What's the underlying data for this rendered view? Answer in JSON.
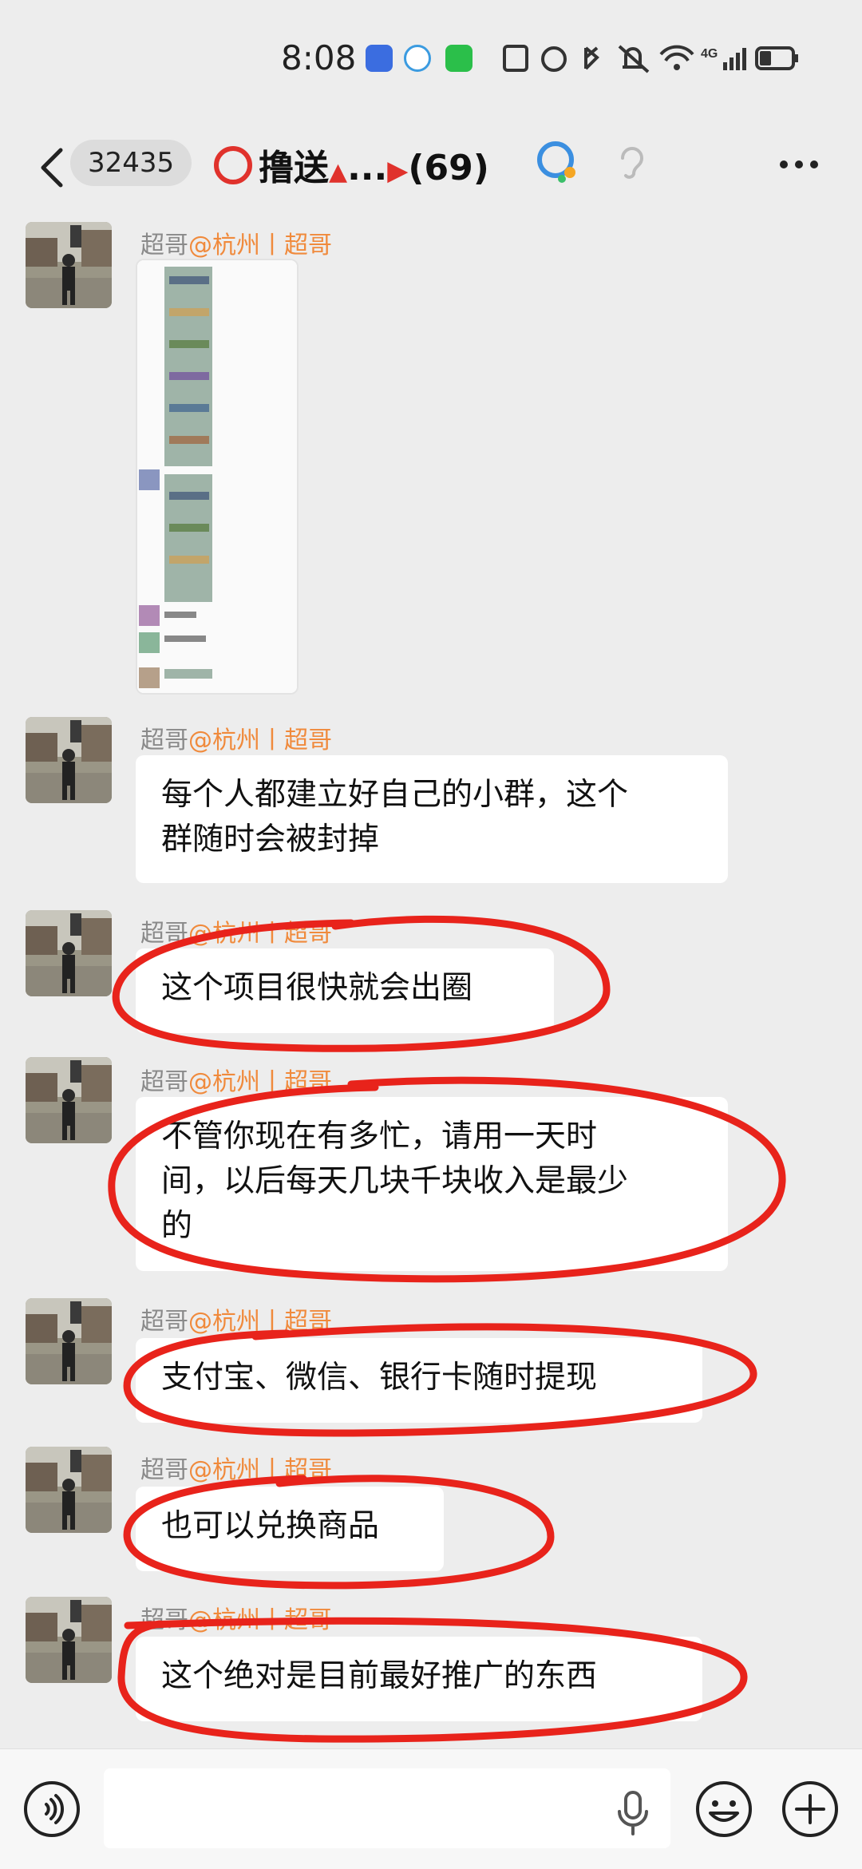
{
  "status_bar": {
    "time": "8:08",
    "network_label": "4G"
  },
  "header": {
    "unread_count": "32435",
    "group_title": "撸送",
    "title_ellipsis": "...",
    "member_count": "(69)"
  },
  "messages": [
    {
      "sender_name": "超哥",
      "sender_tag": "@杭州丨超哥",
      "type": "image"
    },
    {
      "sender_name": "超哥",
      "sender_tag": "@杭州丨超哥",
      "lines": [
        "每个人都建立好自己的小群，这个",
        "群随时会被封掉"
      ]
    },
    {
      "sender_name": "超哥",
      "sender_tag": "@杭州丨超哥",
      "lines": [
        "这个项目很快就会出圈"
      ]
    },
    {
      "sender_name": "超哥",
      "sender_tag": "@杭州丨超哥",
      "lines": [
        "不管你现在有多忙，请用一天时",
        "间，以后每天几块千块收入是最少",
        "的"
      ]
    },
    {
      "sender_name": "超哥",
      "sender_tag": "@杭州丨超哥",
      "lines": [
        "支付宝、微信、银行卡随时提现"
      ]
    },
    {
      "sender_name": "超哥",
      "sender_tag": "@杭州丨超哥",
      "lines": [
        "也可以兑换商品"
      ]
    },
    {
      "sender_name": "超哥",
      "sender_tag": "@杭州丨超哥",
      "lines": [
        "这个绝对是目前最好推广的东西"
      ]
    }
  ],
  "input_bar": {
    "placeholder": ""
  },
  "colors": {
    "annotation_red": "#e8231b",
    "sender_tag_orange": "#f08a3c",
    "background": "#ededed"
  }
}
